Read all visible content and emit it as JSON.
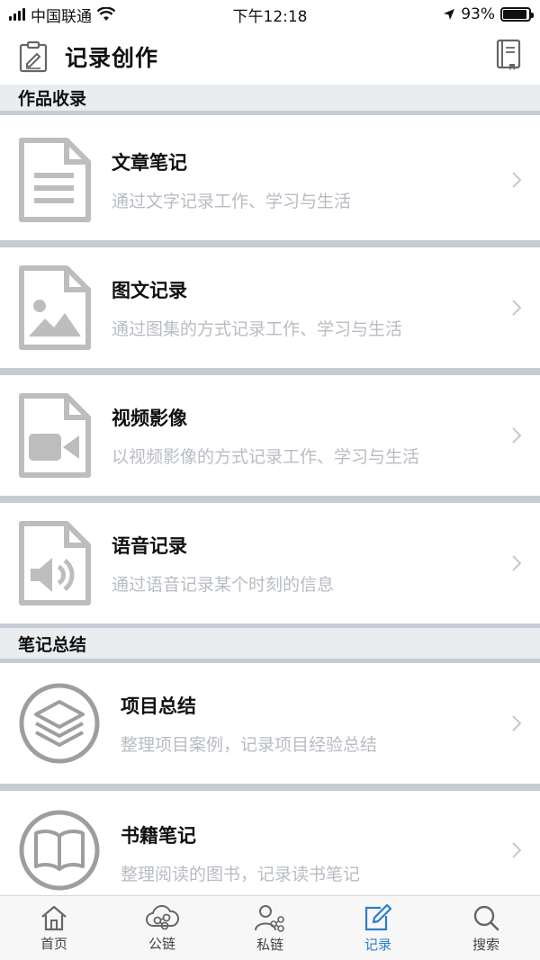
{
  "status_bar": {
    "carrier": "中国联通",
    "time": "下午12:18",
    "battery": "93%",
    "battery_level": 0.93
  },
  "header": {
    "title": "记录创作",
    "left_icon": "clipboard-edit-icon",
    "right_icon": "notebook-icon"
  },
  "sections": [
    {
      "title": "作品收录",
      "items": [
        {
          "title": "文章笔记",
          "desc": "通过文字记录工作、学习与生活",
          "icon": "document-text-icon"
        },
        {
          "title": "图文记录",
          "desc": "通过图集的方式记录工作、学习与生活",
          "icon": "document-image-icon"
        },
        {
          "title": "视频影像",
          "desc": "以视频影像的方式记录工作、学习与生活",
          "icon": "document-video-icon"
        },
        {
          "title": "语音记录",
          "desc": "通过语音记录某个时刻的信息",
          "icon": "document-audio-icon"
        }
      ]
    },
    {
      "title": "笔记总结",
      "items": [
        {
          "title": "项目总结",
          "desc": "整理项目案例，记录项目经验总结",
          "icon": "layers-icon"
        },
        {
          "title": "书籍笔记",
          "desc": "整理阅读的图书，记录读书笔记",
          "icon": "book-icon"
        }
      ]
    }
  ],
  "tabbar": {
    "tabs": [
      {
        "label": "首页",
        "icon": "home-icon"
      },
      {
        "label": "公链",
        "icon": "cloud-link-icon"
      },
      {
        "label": "私链",
        "icon": "user-share-icon"
      },
      {
        "label": "记录",
        "icon": "edit-icon",
        "active": true
      },
      {
        "label": "搜索",
        "icon": "search-icon"
      }
    ]
  },
  "colors": {
    "accent": "#2a7fc9",
    "section_bg": "#eaedf0",
    "separator": "#c6ccd4",
    "icon_gray": "#bdbdbd",
    "desc_gray": "#b8bcc2"
  }
}
